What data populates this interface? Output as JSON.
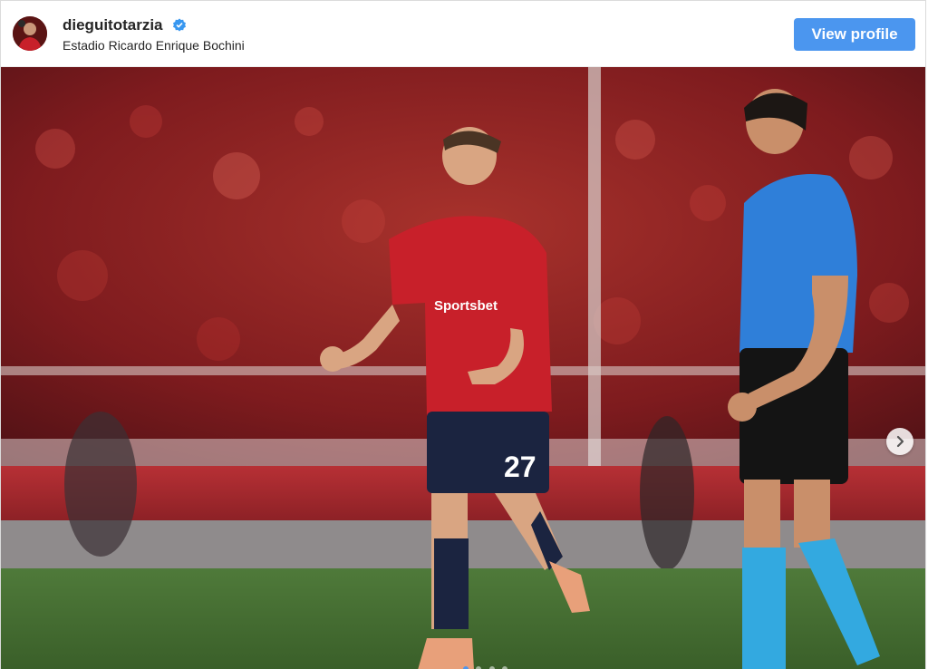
{
  "post": {
    "username": "dieguitotarzia",
    "location": "Estadio Ricardo Enrique Bochini",
    "view_profile_label": "View profile",
    "verified": true
  },
  "photo": {
    "carousel_index": 1,
    "carousel_count": 4,
    "player_number": "27",
    "sponsor": "Sportsbet",
    "colors": {
      "stands": "#8e1d20",
      "jersey_red": "#c8202a",
      "shorts_navy": "#1b2440",
      "referee_blue": "#2f7fd9",
      "pitch_green": "#3f6b2f"
    }
  },
  "colors": {
    "button": "#4b96ef",
    "verified": "#3897f0",
    "text": "#262626"
  }
}
